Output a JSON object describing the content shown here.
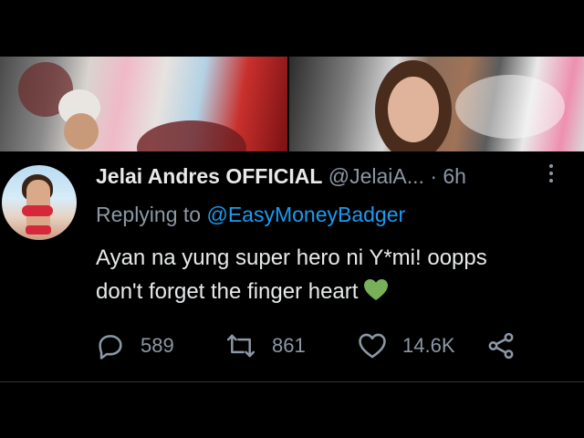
{
  "tweet": {
    "display_name": "Jelai Andres OFFICIAL",
    "handle": "@JelaiA...",
    "separator": "·",
    "time": "6h",
    "replying_prefix": "Replying to",
    "replying_to": "@EasyMoneyBadger",
    "text_line1": "Ayan na yung super hero ni Y*mi! oopps",
    "text_line2": "don't forget the finger heart",
    "emoji": "green-heart-icon"
  },
  "actions": {
    "replies": "589",
    "retweets": "861",
    "likes": "14.6K"
  },
  "colors": {
    "background": "#000000",
    "text": "#e7e9ea",
    "muted": "#8b98a5",
    "link": "#1d9bf0",
    "emoji_heart": "#78b159"
  }
}
